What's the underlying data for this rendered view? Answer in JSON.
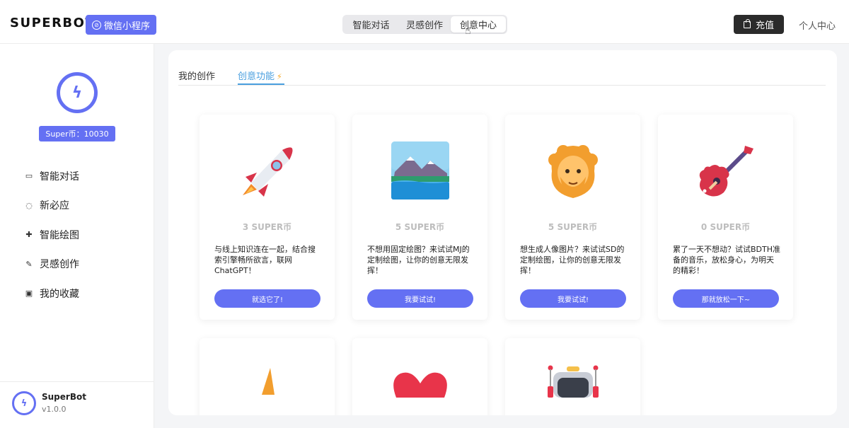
{
  "header": {
    "brand": "SUPERBOT",
    "mini_program_label": "微信小程序",
    "segments": [
      "智能对话",
      "灵感创作",
      "创意中心"
    ],
    "active_segment": "创意中心",
    "recharge_label": "充值",
    "personal_label": "个人中心"
  },
  "sidebar": {
    "coins_label": "Super币：10030",
    "items": [
      {
        "label": "智能对话",
        "icon": "chat-icon"
      },
      {
        "label": "新必应",
        "icon": "bubble-icon"
      },
      {
        "label": "智能绘图",
        "icon": "paint-icon"
      },
      {
        "label": "灵感创作",
        "icon": "pen-icon"
      },
      {
        "label": "我的收藏",
        "icon": "collection-icon"
      }
    ],
    "footer": {
      "name": "SuperBot",
      "version": "v1.0.0"
    }
  },
  "main": {
    "tabs": [
      {
        "label": "我的创作",
        "active": false
      },
      {
        "label": "创意功能",
        "active": true,
        "icon": "flash-icon"
      }
    ],
    "cards": [
      {
        "icon": "rocket-icon",
        "price": "3 SUPER币",
        "desc": "与线上知识连在一起，结合搜索引擎畅所欲言，联网ChatGPT！",
        "cta": "就选它了!"
      },
      {
        "icon": "landscape-icon",
        "price": "5 SUPER币",
        "desc": "不想用固定绘图？来试试MJ的定制绘图，让你的创意无限发挥！",
        "cta": "我要试试!"
      },
      {
        "icon": "person-icon",
        "price": "5 SUPER币",
        "desc": "想生成人像图片？来试试SD的定制绘图，让你的创意无限发挥！",
        "cta": "我要试试!"
      },
      {
        "icon": "guitar-icon",
        "price": "0 SUPER币",
        "desc": "累了一天不想动？试试BDTH准备的音乐，放松身心，为明天的精彩！",
        "cta": "那就放松一下~"
      }
    ],
    "partial_cards": [
      {
        "icon": "cone-icon"
      },
      {
        "icon": "heart-icon"
      },
      {
        "icon": "robot-icon"
      }
    ]
  },
  "colors": {
    "accent": "#6470f3",
    "tab_active": "#4a9fdf",
    "dark_button": "#2b2b2b"
  }
}
